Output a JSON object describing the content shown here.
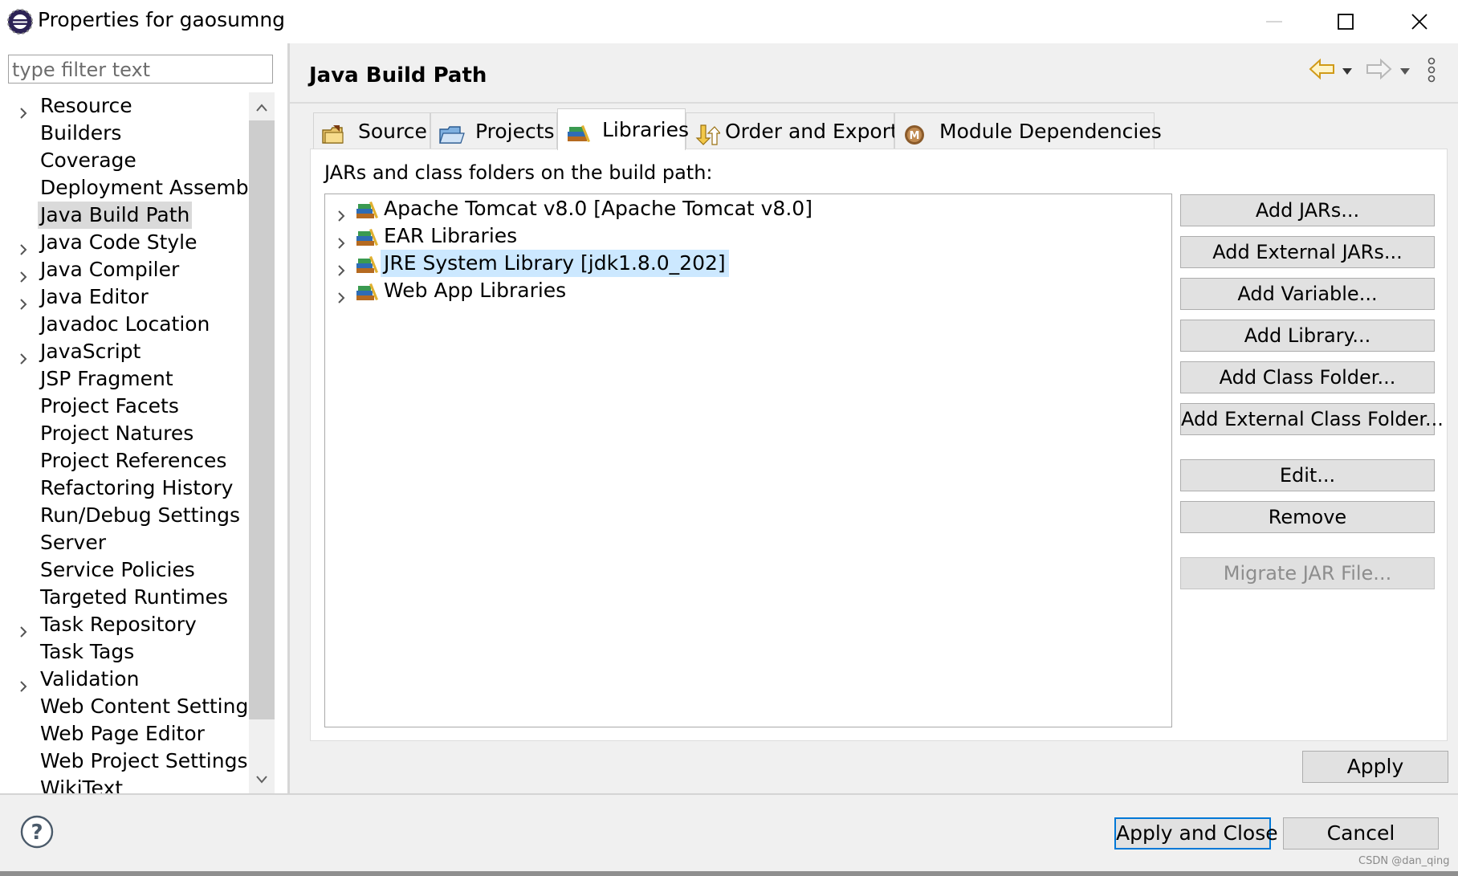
{
  "window": {
    "title": "Properties for gaosumng"
  },
  "filter": {
    "placeholder": "type filter text"
  },
  "tree": {
    "items": [
      {
        "label": "Resource",
        "expandable": true
      },
      {
        "label": "Builders",
        "expandable": false
      },
      {
        "label": "Coverage",
        "expandable": false
      },
      {
        "label": "Deployment Assembly",
        "expandable": false
      },
      {
        "label": "Java Build Path",
        "expandable": false,
        "selected": true
      },
      {
        "label": "Java Code Style",
        "expandable": true
      },
      {
        "label": "Java Compiler",
        "expandable": true
      },
      {
        "label": "Java Editor",
        "expandable": true
      },
      {
        "label": "Javadoc Location",
        "expandable": false
      },
      {
        "label": "JavaScript",
        "expandable": true
      },
      {
        "label": "JSP Fragment",
        "expandable": false
      },
      {
        "label": "Project Facets",
        "expandable": false
      },
      {
        "label": "Project Natures",
        "expandable": false
      },
      {
        "label": "Project References",
        "expandable": false
      },
      {
        "label": "Refactoring History",
        "expandable": false
      },
      {
        "label": "Run/Debug Settings",
        "expandable": false
      },
      {
        "label": "Server",
        "expandable": false
      },
      {
        "label": "Service Policies",
        "expandable": false
      },
      {
        "label": "Targeted Runtimes",
        "expandable": false
      },
      {
        "label": "Task Repository",
        "expandable": true
      },
      {
        "label": "Task Tags",
        "expandable": false
      },
      {
        "label": "Validation",
        "expandable": true
      },
      {
        "label": "Web Content Settings",
        "expandable": false
      },
      {
        "label": "Web Page Editor",
        "expandable": false
      },
      {
        "label": "Web Project Settings",
        "expandable": false
      },
      {
        "label": "WikiText",
        "expandable": false
      }
    ]
  },
  "page": {
    "title": "Java Build Path"
  },
  "tabs": [
    {
      "label": "Source",
      "icon": "source-folder-icon"
    },
    {
      "label": "Projects",
      "icon": "projects-folder-icon"
    },
    {
      "label": "Libraries",
      "icon": "libraries-icon",
      "active": true
    },
    {
      "label": "Order and Export",
      "icon": "order-export-icon"
    },
    {
      "label": "Module Dependencies",
      "icon": "module-icon"
    }
  ],
  "libraries": {
    "label": "JARs and class folders on the build path:",
    "items": [
      {
        "label": "Apache Tomcat v8.0 [Apache Tomcat v8.0]"
      },
      {
        "label": "EAR Libraries"
      },
      {
        "label": "JRE System Library [jdk1.8.0_202]",
        "selected": true
      },
      {
        "label": "Web App Libraries"
      }
    ]
  },
  "buttons": {
    "add_jars": "Add JARs...",
    "add_external_jars": "Add External JARs...",
    "add_variable": "Add Variable...",
    "add_library": "Add Library...",
    "add_class_folder": "Add Class Folder...",
    "add_external_class_folder": "Add External Class Folder...",
    "edit": "Edit...",
    "remove": "Remove",
    "migrate_jar": "Migrate JAR File...",
    "apply": "Apply",
    "apply_and_close": "Apply and Close",
    "cancel": "Cancel"
  },
  "watermark": "CSDN @dan_qing",
  "colors": {
    "selection_tree": "#dadada",
    "selection_list": "#cce8ff",
    "default_button_border": "#0078d7",
    "panel_bg": "#f0f0f0"
  }
}
